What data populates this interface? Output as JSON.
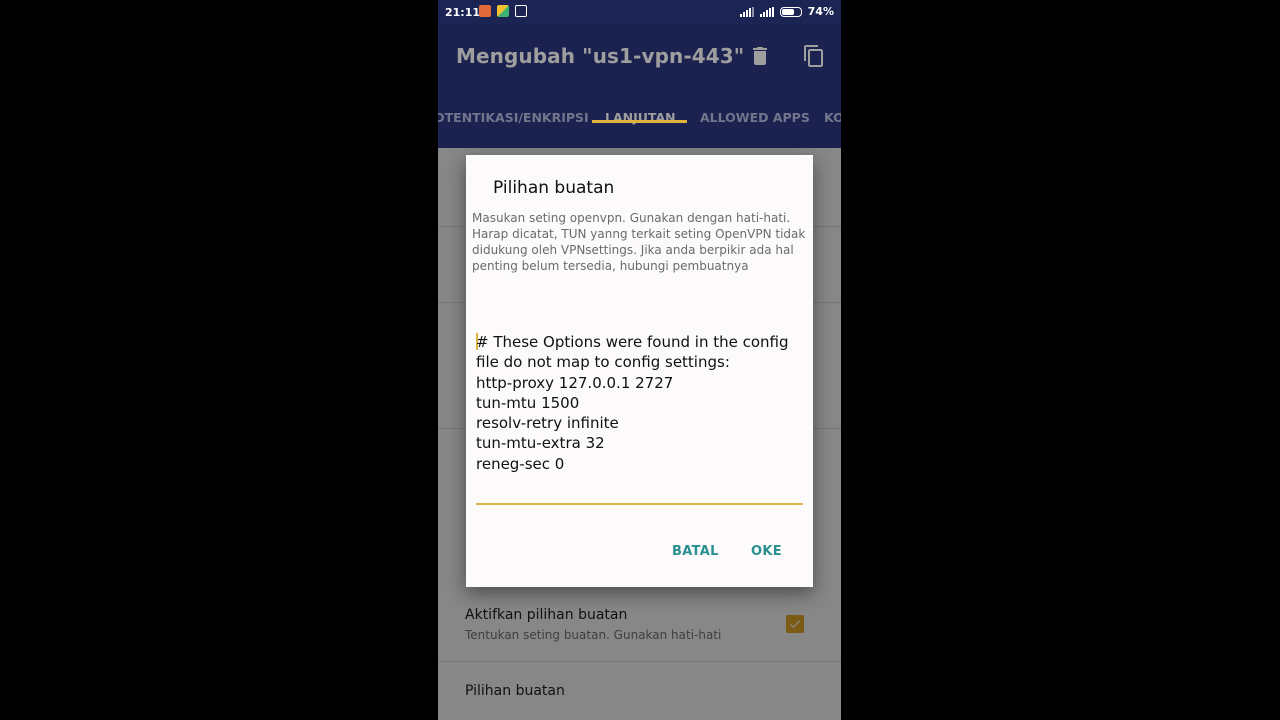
{
  "status_bar": {
    "time": "21:11",
    "battery_percent": "74%",
    "battery_level": 0.74,
    "notification_icons": [
      "app-notification-icon",
      "app-notification-icon",
      "screen-notification-icon"
    ]
  },
  "app_bar": {
    "title": "Mengubah \"us1-vpn-443\"",
    "actions": [
      "trash-icon",
      "copy-icon"
    ]
  },
  "tabs": [
    {
      "label": "OTENTIKASI/ENKRIPSI",
      "active": false
    },
    {
      "label": "LANJUTAN",
      "active": true
    },
    {
      "label": "ALLOWED APPS",
      "active": false
    },
    {
      "label": "KO",
      "active": false
    }
  ],
  "preferences": [
    {
      "title": "Aktifkan pilihan buatan",
      "subtitle": "Tentukan seting buatan. Gunakan hati-hati",
      "checked": true
    },
    {
      "title": "Pilihan buatan",
      "subtitle": ""
    }
  ],
  "dialog": {
    "title": "Pilihan buatan",
    "message": "Masukan seting openvpn. Gunakan dengan hati-hati. Harap dicatat, TUN yanng terkait seting OpenVPN tidak didukung oleh VPNsettings. Jika anda berpikir ada hal penting belum tersedia, hubungi pembuatnya",
    "input_value": "# These Options were found in the config file do not map to config settings:\nhttp-proxy 127.0.0.1 2727\ntun-mtu 1500\nresolv-retry infinite\ntun-mtu-extra 32\nreneg-sec 0",
    "cancel_label": "BATAL",
    "ok_label": "OKE"
  },
  "colors": {
    "primary": "#2c3880",
    "accent": "#e0b43a",
    "dialog_button": "#2a8f8f"
  }
}
